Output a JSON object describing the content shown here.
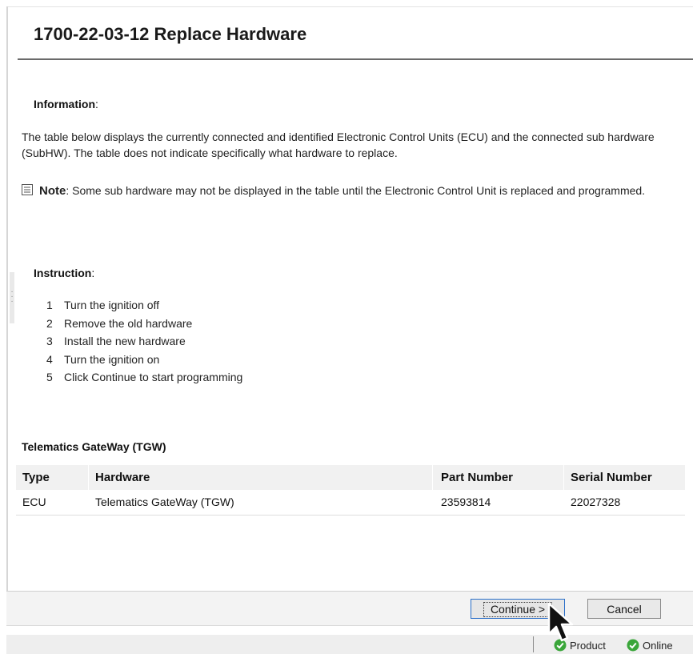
{
  "page": {
    "title": "1700-22-03-12 Replace Hardware"
  },
  "information": {
    "heading": "Information",
    "colon": ":",
    "text": "The table below displays the currently connected and identified Electronic Control Units (ECU) and the connected sub hardware (SubHW). The table does not indicate specifically what hardware to replace.",
    "note_label": "Note",
    "note_text": ": Some sub hardware may not be displayed in the table until the Electronic Control Unit is replaced and programmed.",
    "note_icon": "note-document-icon"
  },
  "instruction": {
    "heading": "Instruction",
    "colon": ":",
    "steps": [
      {
        "num": "1",
        "text": "Turn the ignition off"
      },
      {
        "num": "2",
        "text": "Remove the old hardware"
      },
      {
        "num": "3",
        "text": "Install the new hardware"
      },
      {
        "num": "4",
        "text": "Turn the ignition on"
      },
      {
        "num": "5",
        "text": "Click Continue to start programming"
      }
    ]
  },
  "table": {
    "title": "Telematics GateWay (TGW)",
    "headers": [
      "Type",
      "Hardware",
      "Part Number",
      "Serial Number"
    ],
    "rows": [
      [
        "ECU",
        "Telematics GateWay (TGW)",
        "23593814",
        "22027328"
      ]
    ]
  },
  "footer": {
    "continue_label": "Continue >",
    "cancel_label": "Cancel"
  },
  "statusbar": {
    "product_label": "Product",
    "online_label": "Online",
    "status_color": "#3aa63a"
  }
}
